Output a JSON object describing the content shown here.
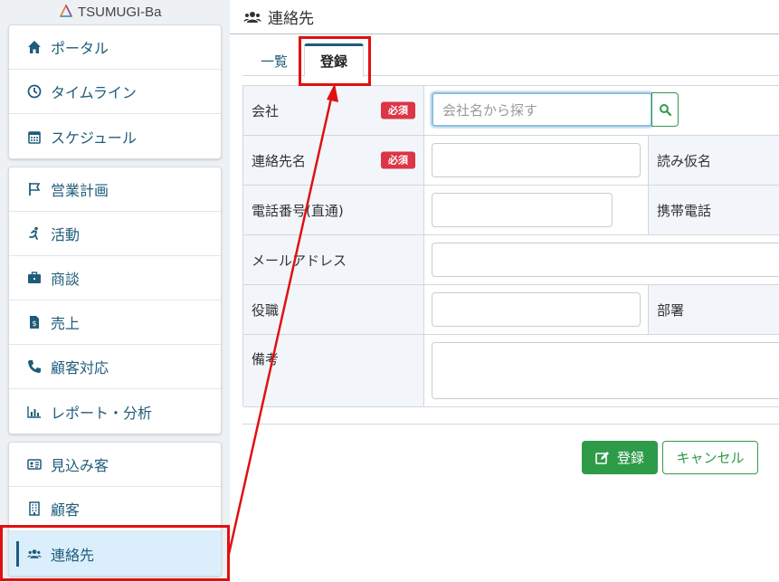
{
  "app": {
    "logo_text": "TSUMUGI-Ba"
  },
  "sidebar": {
    "groups": [
      {
        "items": [
          {
            "label": "ポータル",
            "icon": "home-icon"
          },
          {
            "label": "タイムライン",
            "icon": "clock-icon"
          },
          {
            "label": "スケジュール",
            "icon": "calendar-icon"
          }
        ]
      },
      {
        "items": [
          {
            "label": "営業計画",
            "icon": "flag-icon"
          },
          {
            "label": "活動",
            "icon": "running-icon"
          },
          {
            "label": "商談",
            "icon": "briefcase-icon"
          },
          {
            "label": "売上",
            "icon": "invoice-icon"
          },
          {
            "label": "顧客対応",
            "icon": "phone-icon"
          },
          {
            "label": "レポート・分析",
            "icon": "chart-icon"
          }
        ]
      },
      {
        "items": [
          {
            "label": "見込み客",
            "icon": "id-card-icon"
          },
          {
            "label": "顧客",
            "icon": "building-icon"
          },
          {
            "label": "連絡先",
            "icon": "users-icon",
            "active": true
          }
        ]
      }
    ]
  },
  "header": {
    "title": "連絡先",
    "icon": "users-icon"
  },
  "tabs": [
    {
      "label": "一覧"
    },
    {
      "label": "登録",
      "active": true
    }
  ],
  "form": {
    "required_badge": "必須",
    "company": {
      "label": "会社",
      "placeholder": "会社名から探す"
    },
    "contact_name": {
      "label": "連絡先名"
    },
    "reading_name": {
      "label": "読み仮名"
    },
    "phone_direct": {
      "label": "電話番号(直通)"
    },
    "mobile_phone": {
      "label": "携帯電話"
    },
    "email": {
      "label": "メールアドレス"
    },
    "position": {
      "label": "役職"
    },
    "department": {
      "label": "部署"
    },
    "notes": {
      "label": "備考"
    }
  },
  "buttons": {
    "save": "登録",
    "cancel": "キャンセル"
  },
  "colors": {
    "primary": "#1f5c7a",
    "success": "#2e9b49",
    "danger": "#dc3545",
    "annotation": "#e01010"
  }
}
